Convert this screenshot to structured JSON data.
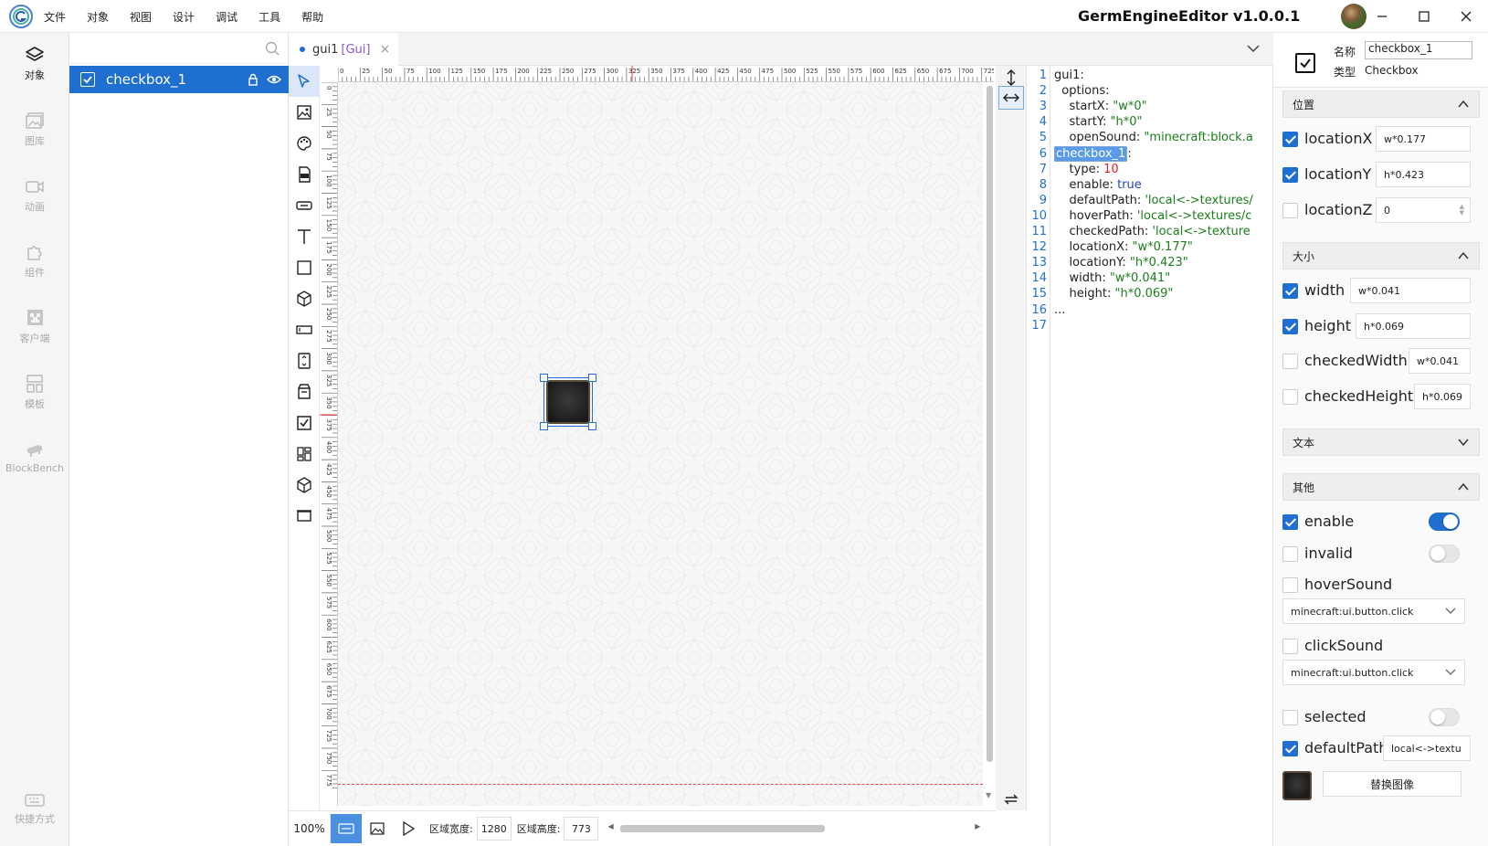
{
  "app": {
    "title": "GermEngineEditor v1.0.0.1",
    "menu": [
      "文件",
      "对象",
      "视图",
      "设计",
      "调试",
      "工具",
      "帮助"
    ]
  },
  "activity": {
    "items": [
      {
        "label": "对象",
        "icon": "layers-icon",
        "active": true
      },
      {
        "label": "图库",
        "icon": "image-gallery-icon",
        "active": false
      },
      {
        "label": "动画",
        "icon": "video-icon",
        "active": false
      },
      {
        "label": "组件",
        "icon": "puzzle-icon",
        "active": false
      },
      {
        "label": "客户端",
        "icon": "minecraft-icon",
        "active": false
      },
      {
        "label": "模板",
        "icon": "template-icon",
        "active": false
      },
      {
        "label": "BlockBench",
        "icon": "blockbench-icon",
        "active": false
      }
    ],
    "shortcut_label": "快捷方式"
  },
  "layers": {
    "search_placeholder": "",
    "items": [
      {
        "label": "checkbox_1",
        "checked": true
      }
    ]
  },
  "editor": {
    "tab": {
      "name": "gui1",
      "kind": "[Gui]",
      "close": "×"
    },
    "ruler_top": [
      "0",
      "25",
      "50",
      "75",
      "100",
      "125",
      "150",
      "175",
      "200",
      "225",
      "250",
      "275",
      "300",
      "325",
      "350",
      "375",
      "400",
      "425",
      "450",
      "475",
      "500",
      "525",
      "550",
      "575",
      "600",
      "625",
      "650",
      "675",
      "700",
      "725"
    ],
    "ruler_left": [
      "0",
      "25",
      "50",
      "75",
      "100",
      "125",
      "150",
      "175",
      "200",
      "225",
      "250",
      "275",
      "300",
      "325",
      "350",
      "375",
      "400",
      "425",
      "450",
      "475",
      "500",
      "525",
      "550",
      "575",
      "600",
      "625",
      "650",
      "675",
      "700",
      "725",
      "750",
      "775"
    ],
    "status": {
      "zoom": "100%",
      "width_label": "区域宽度:",
      "width_value": "1280",
      "height_label": "区域高度:",
      "height_value": "773"
    }
  },
  "code": {
    "lines": [
      {
        "n": "1",
        "parts": [
          [
            "k",
            "gui1:"
          ]
        ]
      },
      {
        "n": "2",
        "parts": [
          [
            "k",
            "  options:"
          ]
        ]
      },
      {
        "n": "3",
        "parts": [
          [
            "k",
            "    startX: "
          ],
          [
            "s",
            "\"w*0\""
          ]
        ]
      },
      {
        "n": "4",
        "parts": [
          [
            "k",
            "    startY: "
          ],
          [
            "s",
            "\"h*0\""
          ]
        ]
      },
      {
        "n": "5",
        "parts": [
          [
            "k",
            "    openSound: "
          ],
          [
            "s",
            "\"minecraft:block.a"
          ]
        ]
      },
      {
        "n": "6",
        "parts": [
          [
            "hl",
            "checkbox_1"
          ],
          [
            "k",
            ":"
          ]
        ]
      },
      {
        "n": "7",
        "parts": [
          [
            "k",
            "    type: "
          ],
          [
            "n",
            "10"
          ]
        ]
      },
      {
        "n": "8",
        "parts": [
          [
            "k",
            "    enable: "
          ],
          [
            "b",
            "true"
          ]
        ]
      },
      {
        "n": "9",
        "parts": [
          [
            "k",
            "    defaultPath: "
          ],
          [
            "s",
            "'local<->textures/"
          ]
        ]
      },
      {
        "n": "10",
        "parts": [
          [
            "k",
            "    hoverPath: "
          ],
          [
            "s",
            "'local<->textures/c"
          ]
        ]
      },
      {
        "n": "11",
        "parts": [
          [
            "k",
            "    checkedPath: "
          ],
          [
            "s",
            "'local<->texture"
          ]
        ]
      },
      {
        "n": "12",
        "parts": [
          [
            "k",
            "    locationX: "
          ],
          [
            "s",
            "\"w*0.177\""
          ]
        ]
      },
      {
        "n": "13",
        "parts": [
          [
            "k",
            "    locationY: "
          ],
          [
            "s",
            "\"h*0.423\""
          ]
        ]
      },
      {
        "n": "14",
        "parts": [
          [
            "k",
            "    width: "
          ],
          [
            "s",
            "\"w*0.041\""
          ]
        ]
      },
      {
        "n": "15",
        "parts": [
          [
            "k",
            "    height: "
          ],
          [
            "s",
            "\"h*0.069\""
          ]
        ]
      },
      {
        "n": "16",
        "parts": [
          [
            "k",
            "..."
          ]
        ]
      },
      {
        "n": "17",
        "parts": []
      }
    ]
  },
  "props": {
    "name_label": "名称",
    "name_value": "checkbox_1",
    "type_label": "类型",
    "type_value": "Checkbox",
    "sections": {
      "position": "位置",
      "size": "大小",
      "text": "文本",
      "other": "其他"
    },
    "position": [
      {
        "label": "locationX",
        "value": "w*0.177",
        "checked": true
      },
      {
        "label": "locationY",
        "value": "h*0.423",
        "checked": true
      },
      {
        "label": "locationZ",
        "value": "0",
        "checked": false
      }
    ],
    "size": [
      {
        "label": "width",
        "value": "w*0.041",
        "checked": true
      },
      {
        "label": "height",
        "value": "h*0.069",
        "checked": true
      },
      {
        "label": "checkedWidth",
        "value": "w*0.041",
        "checked": false
      },
      {
        "label": "checkedHeight",
        "value": "h*0.069",
        "checked": false
      }
    ],
    "other": {
      "enable": {
        "label": "enable",
        "checked": true,
        "toggle": true
      },
      "invalid": {
        "label": "invalid",
        "checked": false,
        "toggle": false
      },
      "hoverSound": {
        "label": "hoverSound",
        "checked": false,
        "select": "minecraft:ui.button.click"
      },
      "clickSound": {
        "label": "clickSound",
        "checked": false,
        "select": "minecraft:ui.button.click"
      },
      "selected": {
        "label": "selected",
        "checked": false,
        "toggle": false
      },
      "defaultPath": {
        "label": "defaultPath",
        "checked": true,
        "value": "local<->textu"
      },
      "replace_label": "替换图像"
    }
  },
  "colors": {
    "accent": "#1f6fd1",
    "string": "#1a7f1a",
    "number": "#e02020",
    "keyword": "#1f44c8"
  }
}
